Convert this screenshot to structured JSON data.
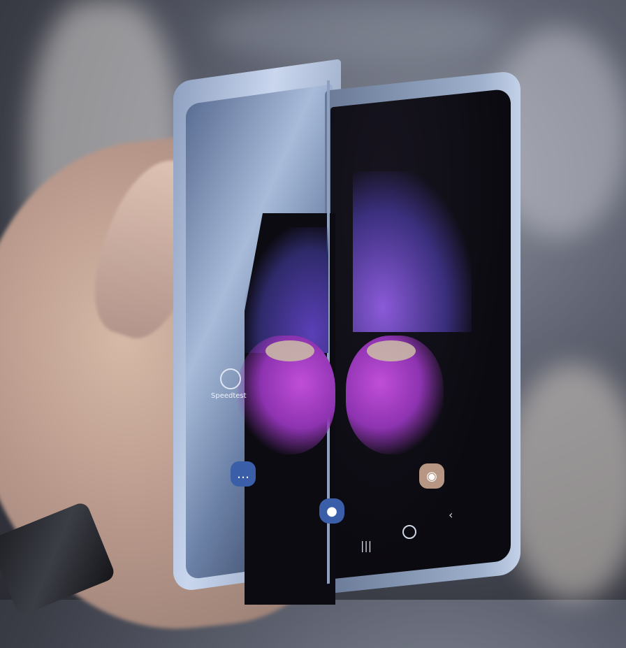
{
  "scene": {
    "subject": "folding-smartphone",
    "left_screen_label": "Speedtest",
    "left_status": "",
    "right_status": "",
    "icons": {
      "speedtest": "speedometer-icon",
      "messages": "chat-bubble-icon",
      "camera": "camera-icon",
      "bixby": "bixby-icon",
      "recents": "recents-icon",
      "home": "home-icon",
      "back": "back-icon"
    },
    "glyphs": {
      "messages": "…",
      "camera": "◉",
      "bixby": "●",
      "recents": "|||",
      "back": "‹"
    },
    "colors": {
      "wing_purple": "#8b5ad8",
      "wing_magenta": "#c04ed8",
      "frame_blue": "#9eb0cc"
    }
  }
}
